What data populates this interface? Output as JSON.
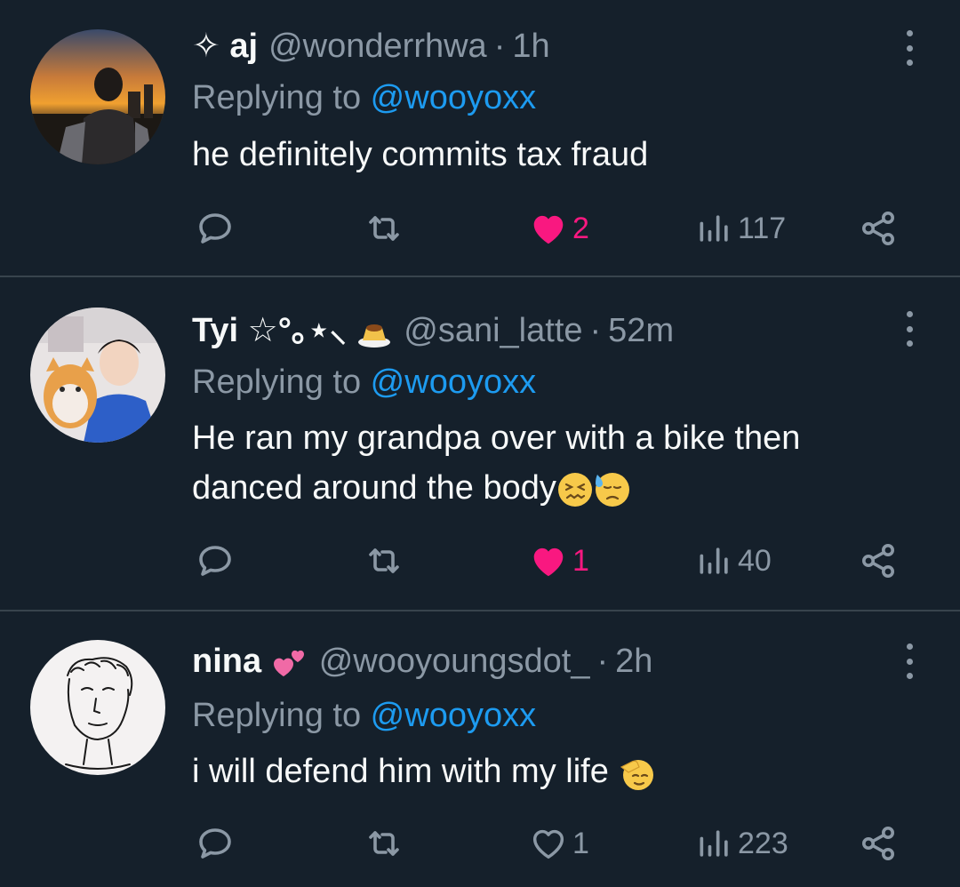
{
  "tweets": [
    {
      "display_name_prefix": "✧ ",
      "display_name": "aj",
      "handle": "@wonderrhwa",
      "dot": "·",
      "time": "1h",
      "replying_label": "Replying to ",
      "replying_to": "@wooyoxx",
      "text": "he definitely commits tax fraud",
      "likes": "2",
      "liked": true,
      "views": "117"
    },
    {
      "display_name": "Tyi ☆°｡⋆⸜",
      "handle": "@sani_latte",
      "dot": "·",
      "time": "52m",
      "replying_label": "Replying to ",
      "replying_to": "@wooyoxx",
      "text_line1": "He ran my grandpa over with a bike then",
      "text_line2": "danced around the body",
      "likes": "1",
      "liked": true,
      "views": "40"
    },
    {
      "display_name": "nina",
      "handle": "@wooyoungsdot_",
      "dot": "·",
      "time": "2h",
      "replying_label": "Replying to ",
      "replying_to": "@wooyoxx",
      "text": "i will defend him with my life",
      "likes": "1",
      "liked": false,
      "views": "223"
    }
  ],
  "colors": {
    "background": "#15202b",
    "text_primary": "#f7f9f9",
    "text_secondary": "#8b98a5",
    "link": "#1d9bf0",
    "like": "#f91880",
    "divider": "#38444d"
  },
  "icons": [
    "reply-icon",
    "retweet-icon",
    "heart-icon",
    "views-icon",
    "share-icon",
    "more-icon"
  ]
}
